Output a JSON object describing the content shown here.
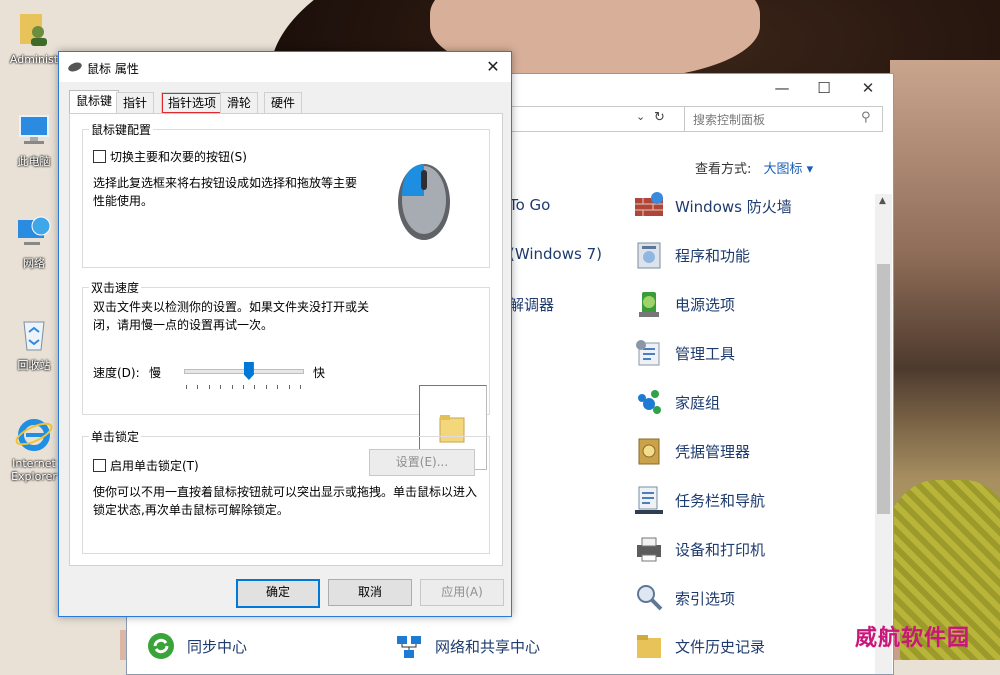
{
  "desktop": {
    "icons": [
      {
        "label": "Administ"
      },
      {
        "label": "此电脑"
      },
      {
        "label": "网络"
      },
      {
        "label": "回收站"
      },
      {
        "label": "Internet Explorer"
      }
    ]
  },
  "control_panel": {
    "search_placeholder": "搜索控制面板",
    "view_label": "查看方式:",
    "view_value": "大图标 ▾",
    "left_items": [
      "To Go",
      "(Windows 7)",
      "解调器"
    ],
    "items": [
      {
        "label": "Windows 防火墙"
      },
      {
        "label": "程序和功能"
      },
      {
        "label": "电源选项"
      },
      {
        "label": "管理工具"
      },
      {
        "label": "家庭组"
      },
      {
        "label": "凭据管理器"
      },
      {
        "label": "任务栏和导航"
      },
      {
        "label": "设备和打印机"
      },
      {
        "label": "索引选项"
      },
      {
        "label": "文件历史记录"
      }
    ],
    "bottom_items": [
      {
        "label": "同步中心"
      },
      {
        "label": "网络和共享中心"
      }
    ]
  },
  "dialog": {
    "title": "鼠标 属性",
    "tabs": [
      "鼠标键",
      "指针",
      "指针选项",
      "滑轮",
      "硬件"
    ],
    "active_tab": "鼠标键",
    "highlighted_tab": "指针选项",
    "button_config": {
      "legend": "鼠标键配置",
      "checkbox_label": "切换主要和次要的按钮(S)",
      "checked": false,
      "description": "选择此复选框来将右按钮设成如选择和拖放等主要性能使用。"
    },
    "double_click": {
      "legend": "双击速度",
      "description": "双击文件夹以检测你的设置。如果文件夹没打开或关闭，请用慢一点的设置再试一次。",
      "speed_label": "速度(D):",
      "slow_label": "慢",
      "fast_label": "快",
      "speed_value": 0.55
    },
    "click_lock": {
      "legend": "单击锁定",
      "checkbox_label": "启用单击锁定(T)",
      "checked": false,
      "settings_button": "设置(E)...",
      "description": "使你可以不用一直按着鼠标按钮就可以突出显示或拖拽。单击鼠标以进入锁定状态,再次单击鼠标可解除锁定。"
    },
    "buttons": {
      "ok": "确定",
      "cancel": "取消",
      "apply": "应用(A)"
    }
  },
  "watermark": "威航软件园",
  "colors": {
    "accent": "#0078d7",
    "highlight_red": "#e0282e",
    "link": "#1e3b6e"
  }
}
